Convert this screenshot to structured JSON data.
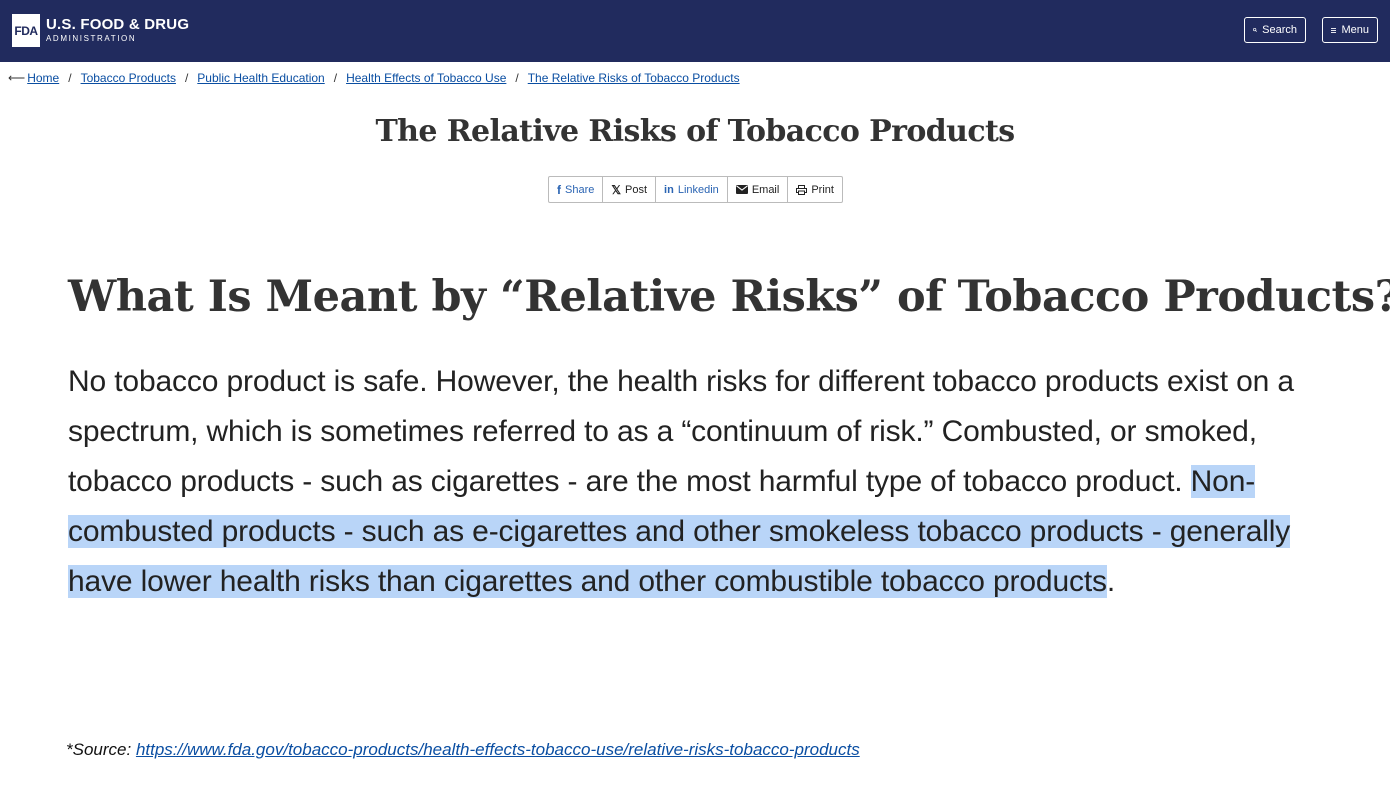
{
  "header": {
    "logo_mark": "FDA",
    "logo_title": "U.S. FOOD & DRUG",
    "logo_subtitle": "ADMINISTRATION",
    "search_label": "Search",
    "menu_label": "Menu",
    "bg_color": "#212b5e"
  },
  "breadcrumb": {
    "items": [
      "Home",
      "Tobacco Products",
      "Public Health Education",
      "Health Effects of Tobacco Use",
      "The Relative Risks of Tobacco Products"
    ],
    "separator": "/"
  },
  "page": {
    "title": "The Relative Risks of Tobacco Products"
  },
  "share": {
    "items": [
      {
        "label": "Share",
        "icon": "facebook-icon"
      },
      {
        "label": "Post",
        "icon": "x-icon"
      },
      {
        "label": "Linkedin",
        "icon": "linkedin-icon"
      },
      {
        "label": "Email",
        "icon": "email-icon"
      },
      {
        "label": "Print",
        "icon": "print-icon"
      }
    ]
  },
  "content": {
    "heading": "What Is Meant by “Relative Risks” of Tobacco Products?",
    "para_plain": "No tobacco product is safe. However, the health risks for different tobacco products exist on a spectrum, which is sometimes referred to as a “continuum of risk.” Combusted, or smoked, tobacco products - such as cigarettes - are the most harmful type of tobacco product. ",
    "para_highlight": "Non-combusted products - such as e-cigarettes and other smokeless tobacco products - generally have lower health risks than cigarettes and other combustible tobacco products",
    "para_end": ".",
    "highlight_color": "#b9d5f8"
  },
  "source": {
    "label": "*Source: ",
    "url": "https://www.fda.gov/tobacco-products/health-effects-tobacco-use/relative-risks-tobacco-products"
  }
}
